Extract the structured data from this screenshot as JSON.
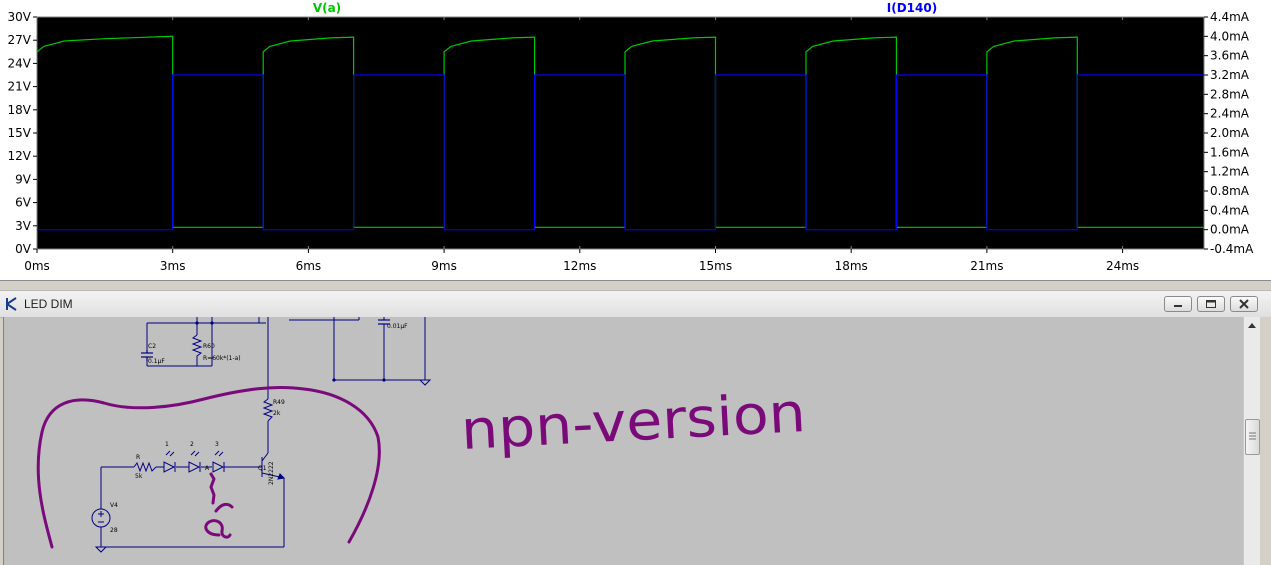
{
  "plot": {
    "traces": [
      {
        "name": "V(a)",
        "color": "#00c800",
        "axis": "left"
      },
      {
        "name": "I(D140)",
        "color": "#0000ff",
        "axis": "right"
      }
    ],
    "left_axis_ticks": [
      "30V",
      "27V",
      "24V",
      "21V",
      "18V",
      "15V",
      "12V",
      "9V",
      "6V",
      "3V",
      "0V"
    ],
    "right_axis_ticks": [
      "4.4mA",
      "4.0mA",
      "3.6mA",
      "3.2mA",
      "2.8mA",
      "2.4mA",
      "2.0mA",
      "1.6mA",
      "1.2mA",
      "0.8mA",
      "0.4mA",
      "0.0mA",
      "-0.4mA"
    ],
    "x_axis_ticks": [
      "0ms",
      "3ms",
      "6ms",
      "9ms",
      "12ms",
      "15ms",
      "18ms",
      "21ms",
      "24ms"
    ],
    "background": "#000000",
    "grid_color": "#808080"
  },
  "chart_data": {
    "type": "line",
    "x_unit": "ms",
    "xlim": [
      0,
      25.8
    ],
    "ylim_left": [
      0,
      30
    ],
    "ylim_right": [
      -0.4,
      4.4
    ],
    "series": [
      {
        "name": "V(a)",
        "axis": "left",
        "x": [
          0,
          0.15,
          0.6,
          1.5,
          3.0,
          3.0,
          5.0,
          5.0,
          5.15,
          5.6,
          6.5,
          7.0,
          7.0,
          9.0,
          9.0,
          9.15,
          9.6,
          10.5,
          11.0,
          11.0,
          13.0,
          13.0,
          13.15,
          13.6,
          14.5,
          15.0,
          15.0,
          17.0,
          17.0,
          17.15,
          17.6,
          18.5,
          19.0,
          19.0,
          21.0,
          21.0,
          21.15,
          21.6,
          22.5,
          23.0,
          23.0,
          25.8
        ],
        "y": [
          25.5,
          26.2,
          26.9,
          27.2,
          27.5,
          2.8,
          2.8,
          25.5,
          26.2,
          26.9,
          27.3,
          27.4,
          2.8,
          2.8,
          25.5,
          26.2,
          26.9,
          27.3,
          27.4,
          2.8,
          2.8,
          25.5,
          26.2,
          26.9,
          27.3,
          27.4,
          2.8,
          2.8,
          25.5,
          26.2,
          26.9,
          27.3,
          27.4,
          2.8,
          2.8,
          25.5,
          26.2,
          26.9,
          27.3,
          27.4,
          2.8,
          2.8
        ]
      },
      {
        "name": "I(D140)",
        "axis": "right",
        "x": [
          0,
          3.0,
          3.0,
          5.0,
          5.0,
          7.0,
          7.0,
          9.0,
          9.0,
          11.0,
          11.0,
          13.0,
          13.0,
          15.0,
          15.0,
          17.0,
          17.0,
          19.0,
          19.0,
          21.0,
          21.0,
          23.0,
          23.0,
          25.8
        ],
        "y": [
          0.0,
          0.0,
          3.2,
          3.2,
          0.0,
          0.0,
          3.2,
          3.2,
          0.0,
          0.0,
          3.2,
          3.2,
          0.0,
          0.0,
          3.2,
          3.2,
          0.0,
          0.0,
          3.2,
          3.2,
          0.0,
          0.0,
          3.2,
          3.2
        ]
      }
    ],
    "grid": false
  },
  "schematic_window": {
    "title": "LED DIM",
    "labels": {
      "c2": "C2",
      "c2_value": "0.1µF",
      "r60": "R60",
      "r60_value": "R=60k*(1-a)",
      "cap_value": "0.01µF",
      "r49": "R49",
      "r49_value": "2k",
      "r": "R",
      "r_value": "5k",
      "led1": "1",
      "led2": "2",
      "led3": "3",
      "node_a": "A",
      "q1": "Q1",
      "q1_part": "2N2222",
      "v4": "V4",
      "v4_value": "28"
    },
    "handwritten_note": "npn-version",
    "handwritten_node": "a",
    "wire_color": "#000080",
    "ink_color": "#7a0a7a"
  }
}
